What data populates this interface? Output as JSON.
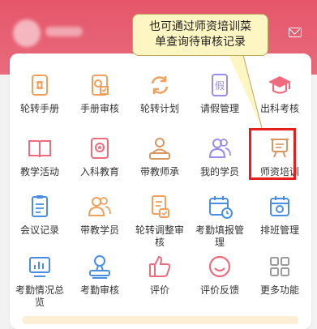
{
  "callout": {
    "line1": "也可通过师资培训菜",
    "line2": "单查询待审核记录"
  },
  "menu": {
    "items": [
      {
        "label": "轮转手册",
        "icon": "rotation-manual-icon"
      },
      {
        "label": "手册审核",
        "icon": "manual-review-icon"
      },
      {
        "label": "轮转计划",
        "icon": "rotation-plan-icon"
      },
      {
        "label": "请假管理",
        "icon": "leave-management-icon"
      },
      {
        "label": "出科考核",
        "icon": "graduation-cap-icon"
      },
      {
        "label": "教学活动",
        "icon": "open-book-icon"
      },
      {
        "label": "入科教育",
        "icon": "department-education-icon"
      },
      {
        "label": "带教师承",
        "icon": "teacher-inheritance-icon"
      },
      {
        "label": "我的学员",
        "icon": "my-students-icon"
      },
      {
        "label": "师资培训",
        "icon": "faculty-training-icon"
      },
      {
        "label": "会议记录",
        "icon": "meeting-record-icon"
      },
      {
        "label": "带教学员",
        "icon": "teaching-students-icon"
      },
      {
        "label": "轮转调整审核",
        "icon": "rotation-adjust-review-icon"
      },
      {
        "label": "考勤填报管理",
        "icon": "attendance-report-icon"
      },
      {
        "label": "排班管理",
        "icon": "shift-schedule-icon"
      },
      {
        "label": "考勤情况总览",
        "icon": "attendance-overview-icon"
      },
      {
        "label": "考勤审核",
        "icon": "attendance-review-icon"
      },
      {
        "label": "评价",
        "icon": "thumbs-up-icon"
      },
      {
        "label": "评价反馈",
        "icon": "smile-feedback-icon"
      },
      {
        "label": "更多功能",
        "icon": "more-functions-icon"
      }
    ]
  },
  "colors": {
    "header": "#e5566a",
    "orange": "#f0a05a",
    "pink": "#ee6b7d",
    "blue": "#4a8ee0",
    "purple": "#9a8ce8",
    "gray": "#9a9a9a",
    "highlight": "#e51e1e",
    "callout_bg": "#fdf6c3"
  }
}
